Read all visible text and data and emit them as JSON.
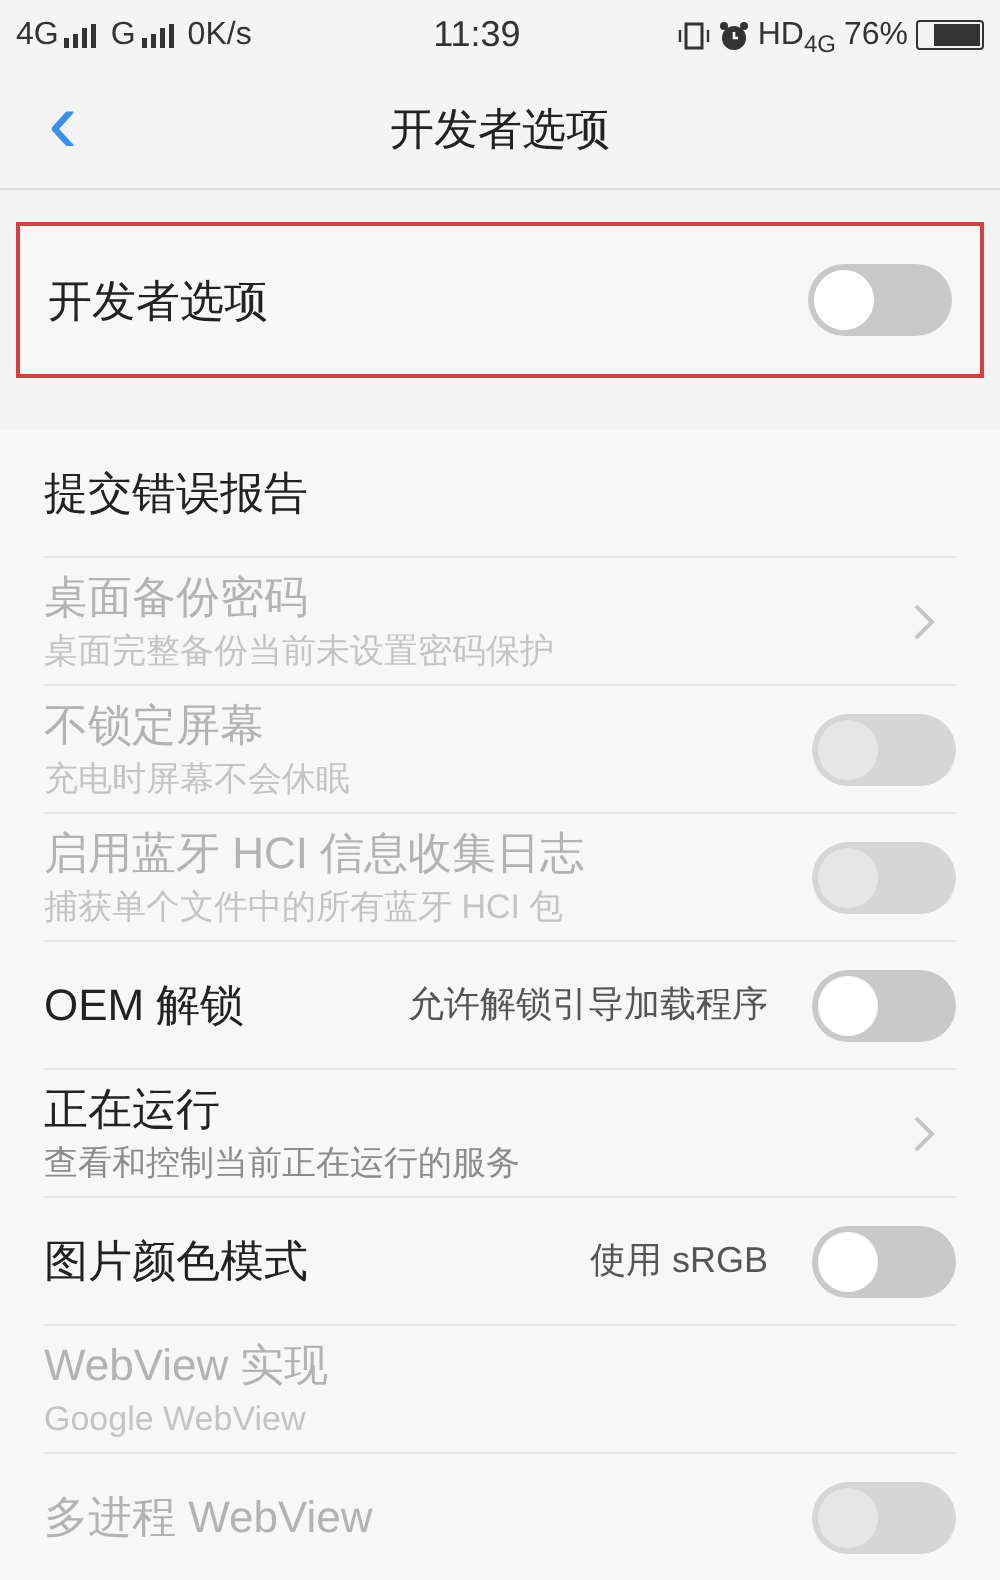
{
  "status_bar": {
    "sim1": "4G",
    "sim2": "G",
    "speed": "0K/s",
    "time": "11:39",
    "hd": "HD",
    "network": "4G",
    "battery": "76%"
  },
  "header": {
    "back": "‹",
    "title": "开发者选项"
  },
  "master": {
    "label": "开发者选项",
    "on": false,
    "highlighted": true
  },
  "items": [
    {
      "kind": "plain",
      "title": "提交错误报告",
      "disabled": false
    },
    {
      "kind": "chevron",
      "title": "桌面备份密码",
      "subtitle": "桌面完整备份当前未设置密码保护",
      "disabled": true
    },
    {
      "kind": "toggle",
      "title": "不锁定屏幕",
      "subtitle": "充电时屏幕不会休眠",
      "disabled": true,
      "on": false
    },
    {
      "kind": "toggle",
      "title": "启用蓝牙 HCI 信息收集日志",
      "subtitle": "捕获单个文件中的所有蓝牙 HCI 包",
      "disabled": true,
      "on": false
    },
    {
      "kind": "toggle",
      "title": "OEM 解锁",
      "value": "允许解锁引导加载程序",
      "disabled": false,
      "on": false
    },
    {
      "kind": "chevron",
      "title": "正在运行",
      "subtitle": "查看和控制当前正在运行的服务",
      "disabled": false
    },
    {
      "kind": "toggle",
      "title": "图片颜色模式",
      "value": "使用 sRGB",
      "disabled": false,
      "on": false
    },
    {
      "kind": "plain",
      "title": "WebView 实现",
      "subtitle": "Google WebView",
      "disabled": true
    },
    {
      "kind": "toggle",
      "title": "多进程 WebView",
      "disabled": true,
      "on": false
    }
  ]
}
